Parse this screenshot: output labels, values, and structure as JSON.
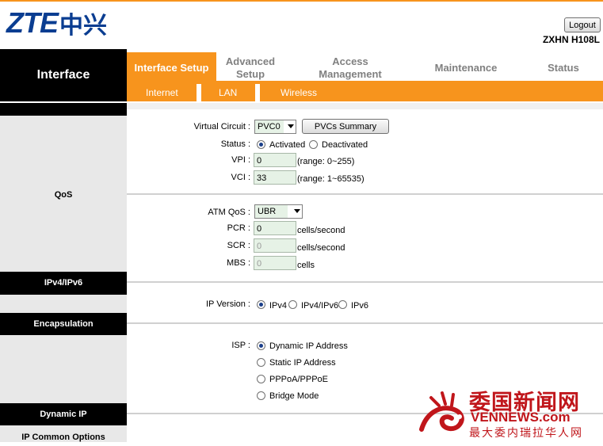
{
  "header": {
    "logo_latin": "ZTE",
    "logo_cn": "中兴",
    "logout_label": "Logout",
    "model": "ZXHN H108L"
  },
  "nav": {
    "section_title": "Interface",
    "tabs": [
      {
        "label": "Interface Setup",
        "active": true
      },
      {
        "label": "Advanced Setup",
        "active": false
      },
      {
        "label": "Access Management",
        "active": false
      },
      {
        "label": "Maintenance",
        "active": false
      },
      {
        "label": "Status",
        "active": false
      }
    ],
    "subtabs": [
      "Internet",
      "LAN",
      "Wireless"
    ]
  },
  "sections": {
    "qos": "QoS",
    "ipv4v6": "IPv4/IPv6",
    "encapsulation": "Encapsulation",
    "dynamic_ip": "Dynamic IP",
    "ip_common": "IP Common Options"
  },
  "form": {
    "virtual_circuit": {
      "label": "Virtual Circuit :",
      "value": "PVC0",
      "summary_button": "PVCs Summary"
    },
    "status": {
      "label": "Status :",
      "options": [
        "Activated",
        "Deactivated"
      ],
      "selected": "Activated"
    },
    "vpi": {
      "label": "VPI :",
      "value": "0",
      "hint": "(range: 0~255)"
    },
    "vci": {
      "label": "VCI :",
      "value": "33",
      "hint": "(range: 1~65535)"
    },
    "atm_qos": {
      "label": "ATM QoS :",
      "value": "UBR"
    },
    "pcr": {
      "label": "PCR :",
      "value": "0",
      "unit": "cells/second"
    },
    "scr": {
      "label": "SCR :",
      "value": "0",
      "unit": "cells/second"
    },
    "mbs": {
      "label": "MBS :",
      "value": "0",
      "unit": "cells"
    },
    "ip_version": {
      "label": "IP Version :",
      "options": [
        "IPv4",
        "IPv4/IPv6",
        "IPv6"
      ],
      "selected": "IPv4"
    },
    "isp": {
      "label": "ISP :",
      "options": [
        "Dynamic IP Address",
        "Static IP Address",
        "PPPoA/PPPoE",
        "Bridge Mode"
      ],
      "selected": "Dynamic IP Address"
    }
  },
  "watermark": {
    "line1": "委国新闻网",
    "line2": "VENNEWS.com",
    "line3": "最大委内瑞拉华人网"
  },
  "colors": {
    "accent": "#f7941d",
    "brand": "#0a3d91",
    "input_bg": "#e6f2e6"
  }
}
